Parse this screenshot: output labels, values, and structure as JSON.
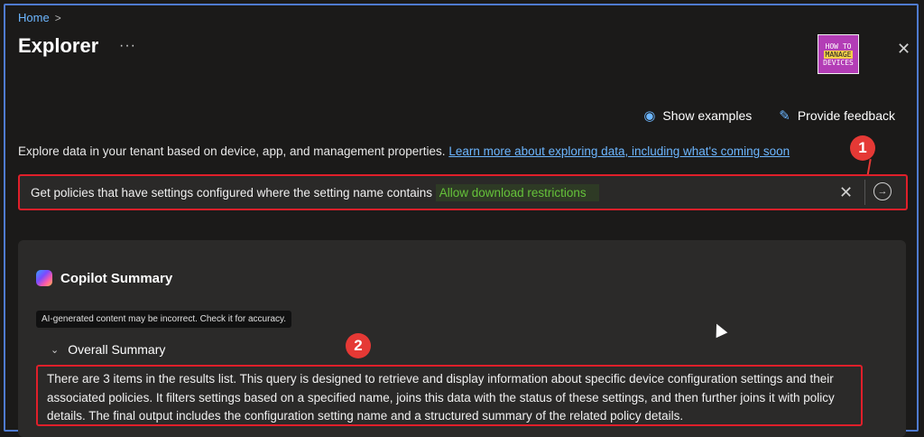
{
  "breadcrumb": {
    "home": "Home",
    "separator": ">"
  },
  "page": {
    "title": "Explorer",
    "more": "···",
    "close": "✕"
  },
  "logo": {
    "line1": "HOW TO",
    "line2": "MANAGE",
    "line3": "DEVICES"
  },
  "actions": {
    "show_examples": {
      "label": "Show examples",
      "icon": "eye-icon"
    },
    "provide_feedback": {
      "label": "Provide feedback",
      "icon": "feedback-icon"
    }
  },
  "description": {
    "text": "Explore data in your tenant based on device, app, and management properties.",
    "link": "Learn more about exploring data, including what's coming soon"
  },
  "query": {
    "prefix": "Get policies that have settings configured where the setting name contains",
    "highlight": "Allow download restrictions",
    "clear": "✕",
    "submit": "→"
  },
  "markers": {
    "one": "1",
    "two": "2"
  },
  "copilot": {
    "title": "Copilot Summary",
    "disclaimer": "AI-generated content may be incorrect. Check it for accuracy.",
    "section_label": "Overall Summary",
    "chevron": "⌄",
    "summary": "There are 3 items in the results list. This query is designed to retrieve and display information about specific device configuration settings and their associated policies. It filters settings based on a specified name, joins this data with the status of these settings, and then further joins it with policy details. The final output includes the configuration setting name and a structured summary of the related policy details."
  },
  "colors": {
    "accent": "#6cb6ff",
    "highlight_text": "#65c23a",
    "annotation_red": "#e01f2a",
    "background": "#1b1a19"
  }
}
